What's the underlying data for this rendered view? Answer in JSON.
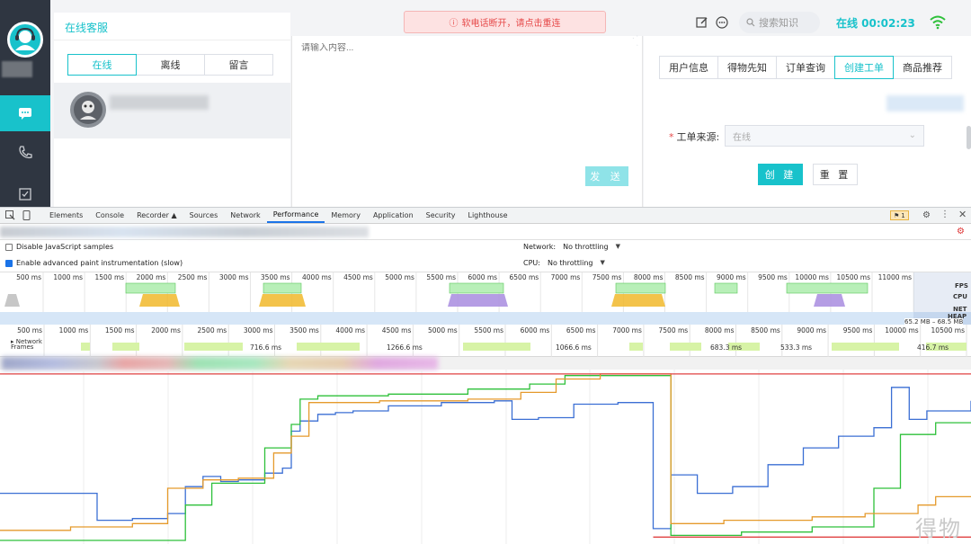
{
  "app": {
    "title": "在线客服",
    "status_tabs": [
      "在线",
      "离线",
      "留言"
    ],
    "chat_placeholder": "请输入内容...",
    "send_label": "发 送",
    "banner_text": "软电话断开，请点击重连",
    "search_placeholder": "搜索知识",
    "online_status": "在线 00:02:23",
    "right_tabs": [
      "用户信息",
      "得物先知",
      "订单查询",
      "创建工单",
      "商品推荐"
    ],
    "form_label": "工单来源:",
    "form_select_value": "在线",
    "create_label": "创 建",
    "reset_label": "重 置",
    "corner_watermark": "得物",
    "colors": {
      "accent": "#18c2cb",
      "sidebar": "#2f3641",
      "banner_text": "#e64a4a"
    }
  },
  "devtools": {
    "tabs": [
      "Elements",
      "Console",
      "Recorder",
      "Sources",
      "Network",
      "Performance",
      "Memory",
      "Application",
      "Security",
      "Lighthouse"
    ],
    "active_tab": "Performance",
    "issues_badge": "1",
    "checkbox_disable_js": "Disable JavaScript samples",
    "checkbox_paint": "Enable advanced paint instrumentation (slow)",
    "network_label": "Network:",
    "network_value": "No throttling",
    "cpu_label": "CPU:",
    "cpu_value": "No throttling",
    "overview_ticks": [
      "500 ms",
      "1000 ms",
      "1500 ms",
      "2000 ms",
      "2500 ms",
      "3000 ms",
      "3500 ms",
      "4000 ms",
      "4500 ms",
      "5000 ms",
      "5500 ms",
      "6000 ms",
      "6500 ms",
      "7000 ms",
      "7500 ms",
      "8000 ms",
      "8500 ms",
      "9000 ms",
      "9500 ms",
      "10000 ms",
      "10500 ms",
      "11000 ms"
    ],
    "lane_labels": [
      "FPS",
      "CPU",
      "NET",
      "HEAP"
    ],
    "heap_range": "65.2 MB – 68.5 MB",
    "timeline_ticks": [
      "500 ms",
      "1000 ms",
      "1500 ms",
      "2000 ms",
      "2500 ms",
      "3000 ms",
      "3500 ms",
      "4000 ms",
      "4500 ms",
      "5000 ms",
      "5500 ms",
      "6000 ms",
      "6500 ms",
      "7000 ms",
      "7500 ms",
      "8000 ms",
      "8500 ms",
      "9000 ms",
      "9500 ms",
      "10000 ms",
      "10500 ms"
    ],
    "track_network": "Network",
    "track_frames": "Frames",
    "frame_durations": [
      "716.6 ms",
      "1266.6 ms",
      "1066.6 ms",
      "683.3 ms",
      "533.3 ms",
      "416.7 ms"
    ]
  },
  "chart_data": {
    "type": "line",
    "title": "",
    "xlabel": "",
    "ylabel": "",
    "xlim": [
      0,
      11000
    ],
    "ylim": [
      0,
      1
    ],
    "x_unit": "ms",
    "series": [
      {
        "color": "#3b6fd4",
        "x": [
          0,
          800,
          1100,
          1500,
          1900,
          2100,
          2300,
          2500,
          2700,
          3000,
          3200,
          3300,
          3400,
          3600,
          3800,
          4000,
          4400,
          5000,
          5600,
          5800,
          6100,
          6500,
          7000,
          7400,
          7600,
          7900,
          8300,
          8700,
          9100,
          9500,
          9900,
          10100,
          10300,
          10500,
          11000
        ],
        "y": [
          0.28,
          0.28,
          0.12,
          0.13,
          0.16,
          0.32,
          0.38,
          0.35,
          0.36,
          0.4,
          0.43,
          0.65,
          0.71,
          0.75,
          0.76,
          0.77,
          0.8,
          0.82,
          0.83,
          0.72,
          0.73,
          0.81,
          0.82,
          0.07,
          0.39,
          0.28,
          0.32,
          0.45,
          0.55,
          0.62,
          0.67,
          0.91,
          0.72,
          0.77,
          0.83
        ]
      },
      {
        "color": "#2ec03a",
        "x": [
          0,
          900,
          1800,
          2100,
          2400,
          2700,
          3000,
          3300,
          3400,
          3600,
          4400,
          5300,
          6000,
          6400,
          7400,
          7600,
          7900,
          8400,
          9200,
          9900,
          10200,
          10600,
          11000
        ],
        "y": [
          0.0,
          0.0,
          0.0,
          0.21,
          0.34,
          0.34,
          0.55,
          0.69,
          0.84,
          0.86,
          0.87,
          0.9,
          0.93,
          0.98,
          0.98,
          0.03,
          0.03,
          0.05,
          0.08,
          0.31,
          0.63,
          0.7,
          0.7
        ]
      },
      {
        "color": "#e59a2c",
        "x": [
          0,
          800,
          1500,
          1900,
          2300,
          2700,
          3100,
          3300,
          3500,
          4300,
          5300,
          5900,
          6300,
          6800,
          7400,
          7600,
          8200,
          9200,
          9800,
          10400,
          10600,
          11000
        ],
        "y": [
          0.06,
          0.08,
          0.1,
          0.31,
          0.36,
          0.37,
          0.52,
          0.62,
          0.82,
          0.83,
          0.84,
          0.88,
          0.96,
          0.99,
          0.99,
          0.1,
          0.12,
          0.14,
          0.16,
          0.21,
          0.26,
          0.26
        ]
      },
      {
        "color": "#e04141",
        "x": [
          0,
          11000
        ],
        "y": [
          0.99,
          0.99
        ]
      },
      {
        "color": "#e04141",
        "x": [
          7400,
          11000
        ],
        "y": [
          0.02,
          0.02
        ]
      }
    ]
  }
}
